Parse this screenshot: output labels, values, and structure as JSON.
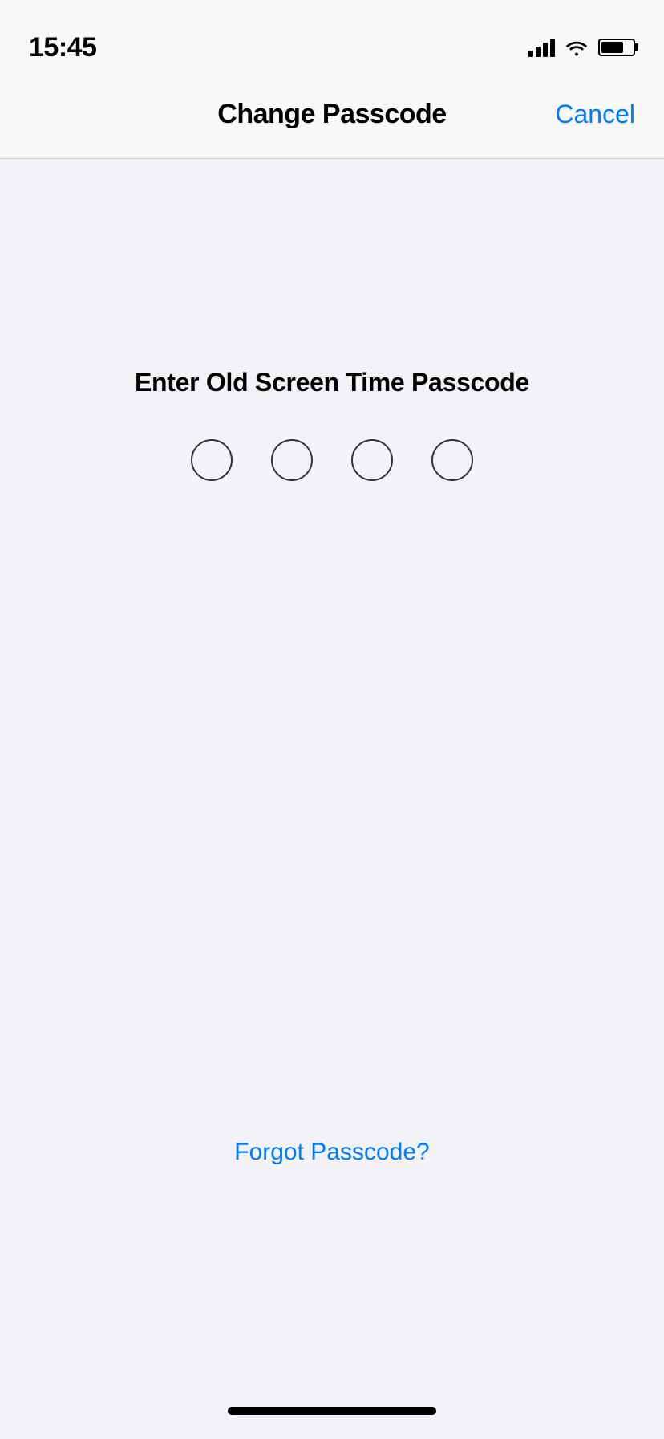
{
  "statusBar": {
    "time": "15:45",
    "signalBars": [
      8,
      13,
      18,
      23
    ],
    "batteryPercent": 70
  },
  "navBar": {
    "title": "Change Passcode",
    "cancelLabel": "Cancel"
  },
  "passcode": {
    "prompt": "Enter Old Screen Time Passcode",
    "dotCount": 4,
    "forgotLabel": "Forgot Passcode?"
  },
  "colors": {
    "accent": "#007aff",
    "text": "#000000",
    "background": "#f2f2f7",
    "navBackground": "#f8f8f8",
    "dotBorder": "#333333"
  }
}
